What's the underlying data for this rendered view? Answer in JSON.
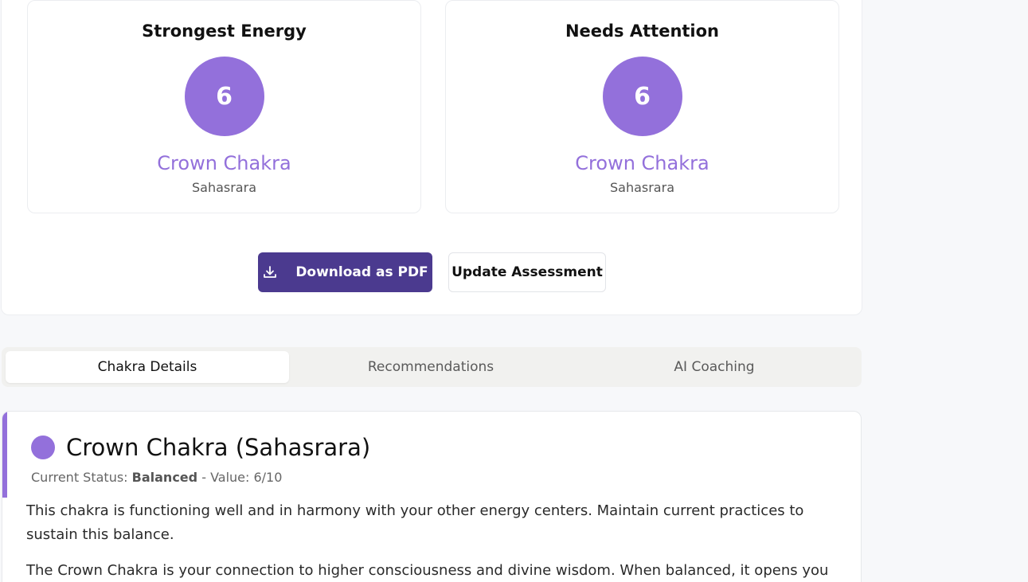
{
  "colors": {
    "accent_purple": "#9370db",
    "primary_button": "#4b3a8f"
  },
  "summary": {
    "strongest": {
      "title": "Strongest Energy",
      "value": "6",
      "name": "Crown Chakra",
      "sanskrit": "Sahasrara"
    },
    "attention": {
      "title": "Needs Attention",
      "value": "6",
      "name": "Crown Chakra",
      "sanskrit": "Sahasrara"
    },
    "buttons": {
      "download_label": "Download as PDF",
      "download_icon": "download-icon",
      "update_label": "Update Assessment"
    }
  },
  "tabs": [
    {
      "label": "Chakra Details",
      "active": true
    },
    {
      "label": "Recommendations",
      "active": false
    },
    {
      "label": "AI Coaching",
      "active": false
    }
  ],
  "detail": {
    "title": "Crown Chakra (Sahasrara)",
    "status_prefix": "Current Status:",
    "status_value": "Balanced",
    "value_text": "- Value: 6/10",
    "paragraph1": "This chakra is functioning well and in harmony with your other energy centers. Maintain current practices to sustain this balance.",
    "paragraph2": "The Crown Chakra is your connection to higher consciousness and divine wisdom. When balanced, it opens you to"
  }
}
